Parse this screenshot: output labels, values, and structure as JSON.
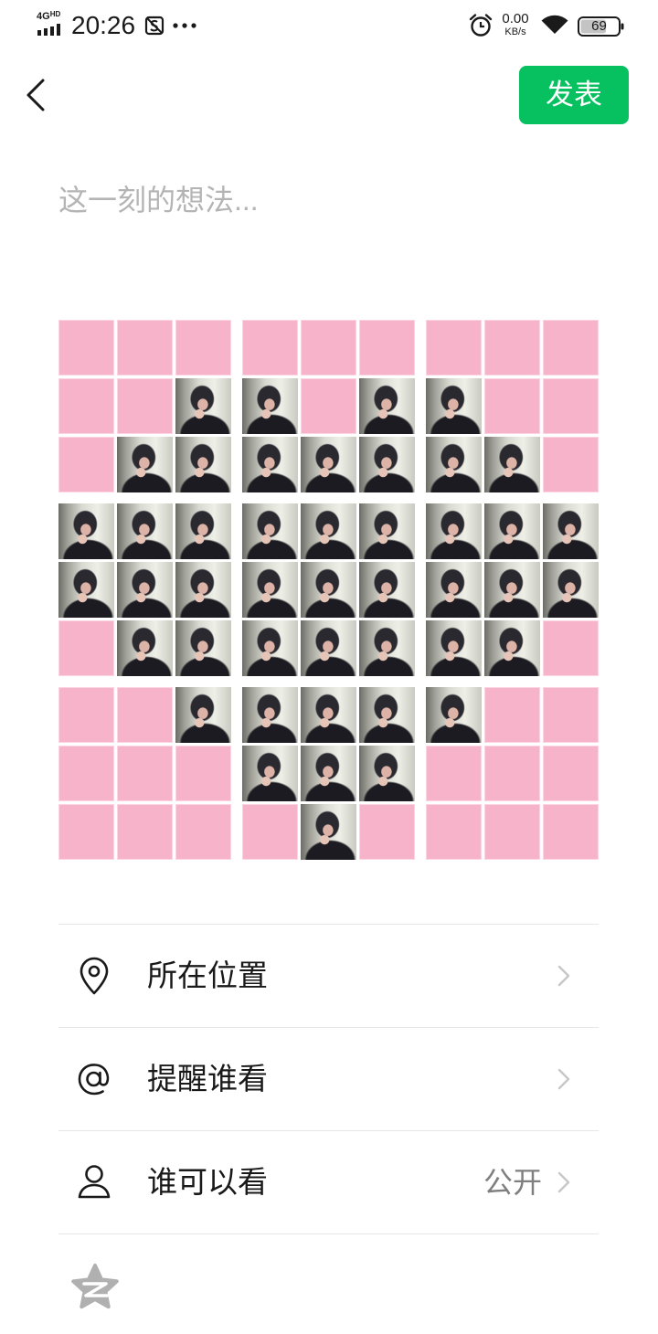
{
  "status_bar": {
    "network": "4G",
    "network_badge": "HD",
    "time": "20:26",
    "speed_value": "0.00",
    "speed_unit": "KB/s",
    "battery": "69",
    "icons": [
      "signal-icon",
      "screenshot-blocked-icon",
      "more-notifications-icon",
      "alarm-icon",
      "wifi-icon",
      "battery-icon"
    ]
  },
  "header": {
    "back_icon": "chevron-left-icon",
    "publish_label": "发表"
  },
  "composer": {
    "placeholder": "这一刻的想法...",
    "images": [
      {
        "tiles": [
          0,
          0,
          0,
          0,
          0,
          1,
          0,
          1,
          1
        ]
      },
      {
        "tiles": [
          0,
          0,
          0,
          1,
          0,
          1,
          1,
          1,
          1
        ]
      },
      {
        "tiles": [
          0,
          0,
          0,
          1,
          0,
          0,
          1,
          1,
          0
        ]
      },
      {
        "tiles": [
          1,
          1,
          1,
          1,
          1,
          1,
          0,
          1,
          1
        ]
      },
      {
        "tiles": [
          1,
          1,
          1,
          1,
          1,
          1,
          1,
          1,
          1
        ]
      },
      {
        "tiles": [
          1,
          1,
          1,
          1,
          1,
          1,
          1,
          1,
          0
        ]
      },
      {
        "tiles": [
          0,
          0,
          1,
          0,
          0,
          0,
          0,
          0,
          0
        ]
      },
      {
        "tiles": [
          1,
          1,
          1,
          1,
          1,
          1,
          0,
          1,
          0
        ]
      },
      {
        "tiles": [
          1,
          0,
          0,
          0,
          0,
          0,
          0,
          0,
          0
        ]
      }
    ]
  },
  "options": [
    {
      "label": "所在位置",
      "icon": "location-pin-icon"
    },
    {
      "label": "提醒谁看",
      "icon": "at-sign-icon"
    },
    {
      "label": "谁可以看",
      "value": "公开",
      "icon": "person-icon"
    }
  ],
  "share": {
    "icon": "qzone-icon"
  },
  "colors": {
    "accent": "#07C160",
    "tile_pink": "#F7B3C9",
    "text": "#191919",
    "secondary_text": "#7F7F7F",
    "divider": "#E6E6E6"
  }
}
